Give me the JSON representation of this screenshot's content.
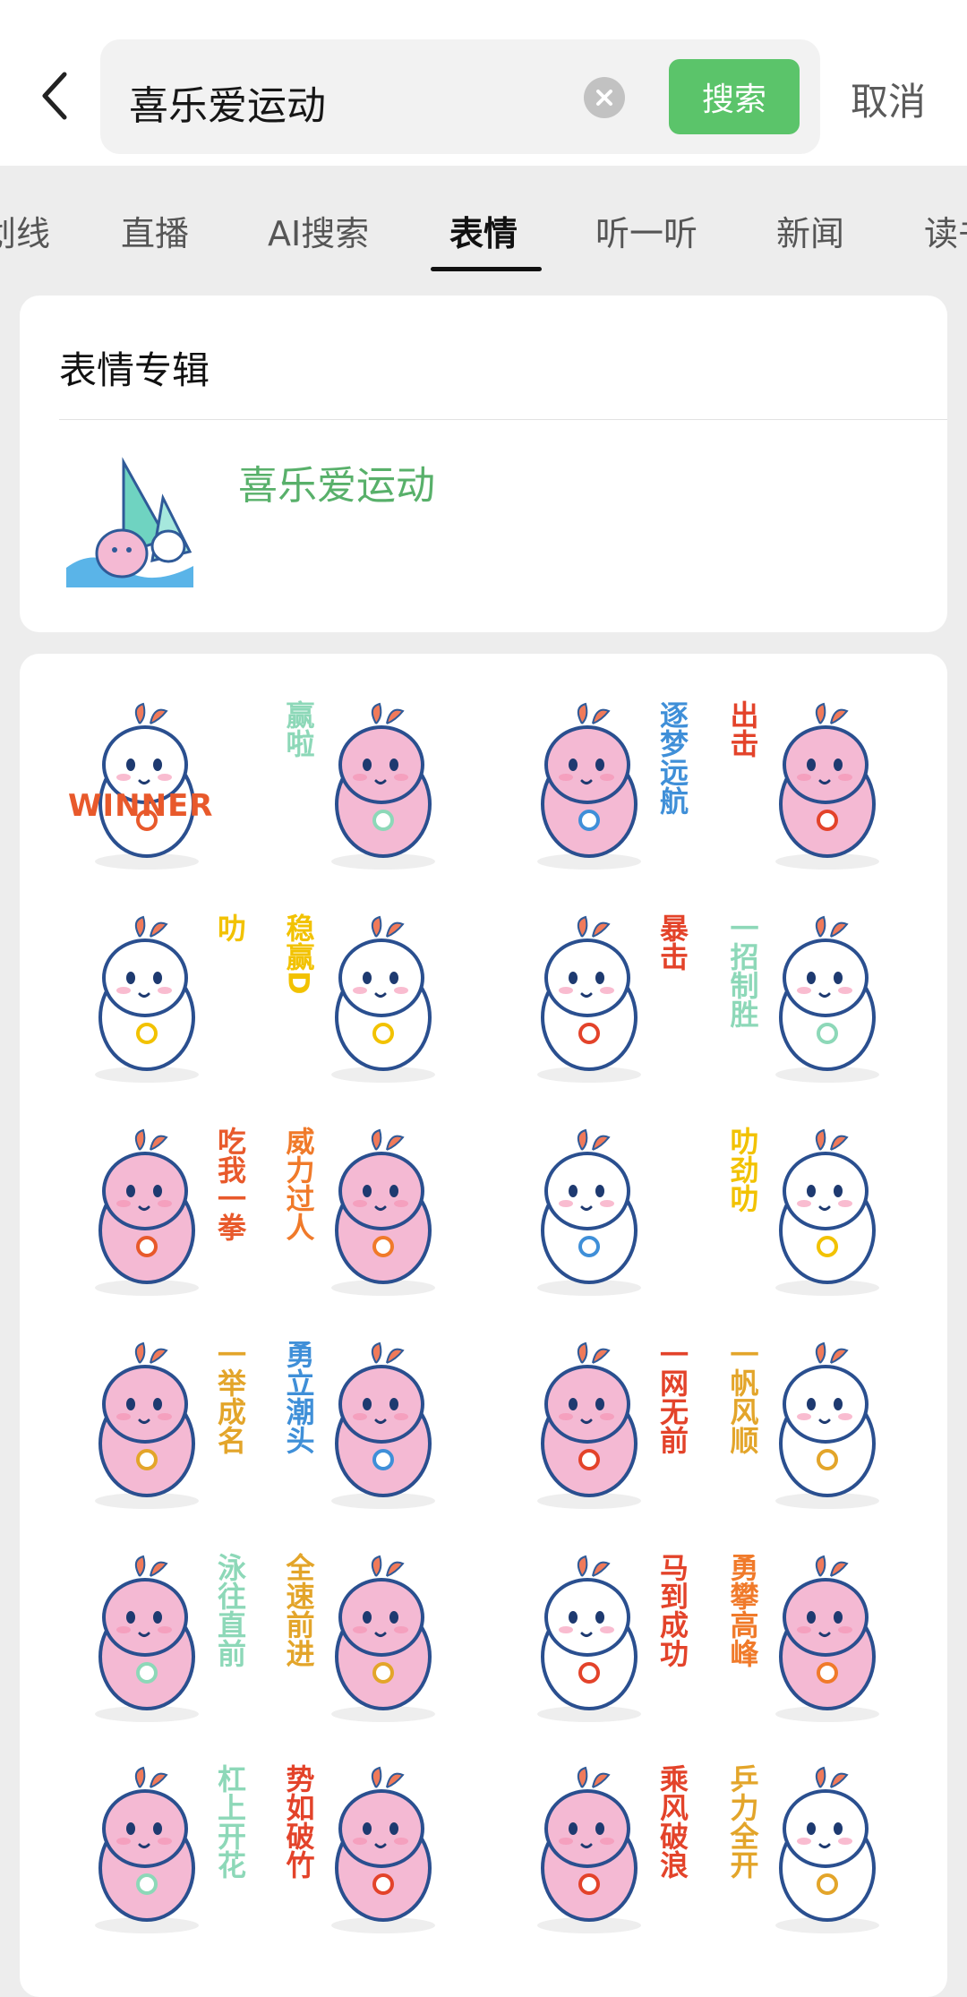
{
  "search": {
    "query": "喜乐爱运动",
    "button_label": "搜索",
    "cancel_label": "取消"
  },
  "tabs": [
    {
      "label": "划线"
    },
    {
      "label": "直播"
    },
    {
      "label": "AI搜索"
    },
    {
      "label": "表情",
      "active": true
    },
    {
      "label": "听一听"
    },
    {
      "label": "新闻"
    },
    {
      "label": "读书"
    }
  ],
  "album": {
    "heading": "表情专辑",
    "name": "喜乐爱运动"
  },
  "stickers": [
    {
      "text": "WINNER",
      "color": "#e8592b",
      "body": "white"
    },
    {
      "text": "赢啦",
      "color": "#8dd8b8",
      "body": "pink"
    },
    {
      "text": "逐梦远航",
      "color": "#3f8fd8",
      "body": "pink"
    },
    {
      "text": "出击",
      "color": "#e3432a",
      "body": "pink"
    },
    {
      "text": "叻",
      "color": "#f2c200",
      "body": "white"
    },
    {
      "text": "稳赢D",
      "color": "#f2c200",
      "body": "white"
    },
    {
      "text": "暴击",
      "color": "#e3432a",
      "body": "white"
    },
    {
      "text": "一招制胜",
      "color": "#8dd8b8",
      "body": "white"
    },
    {
      "text": "吃我一拳",
      "color": "#e8592b",
      "body": "pink"
    },
    {
      "text": "威力过人",
      "color": "#f07a2a",
      "body": "pink"
    },
    {
      "text": "",
      "color": "#3f8fd8",
      "body": "white"
    },
    {
      "text": "叻劲叻",
      "color": "#f2c200",
      "body": "white"
    },
    {
      "text": "一举成名",
      "color": "#e3a52a",
      "body": "pink"
    },
    {
      "text": "勇立潮头",
      "color": "#3f8fd8",
      "body": "pink"
    },
    {
      "text": "一网无前",
      "color": "#e3432a",
      "body": "pink"
    },
    {
      "text": "一帆风顺",
      "color": "#e3a52a",
      "body": "white"
    },
    {
      "text": "泳往直前",
      "color": "#8dd8b8",
      "body": "pink"
    },
    {
      "text": "全速前进",
      "color": "#e3a52a",
      "body": "pink"
    },
    {
      "text": "马到成功",
      "color": "#e3432a",
      "body": "white"
    },
    {
      "text": "勇攀高峰",
      "color": "#f07a2a",
      "body": "pink"
    },
    {
      "text": "杠上开花",
      "color": "#8dd8b8",
      "body": "pink"
    },
    {
      "text": "势如破竹",
      "color": "#e3432a",
      "body": "pink"
    },
    {
      "text": "乘风破浪",
      "color": "#e3432a",
      "body": "pink"
    },
    {
      "text": "乒力全开",
      "color": "#e3a52a",
      "body": "white"
    }
  ]
}
